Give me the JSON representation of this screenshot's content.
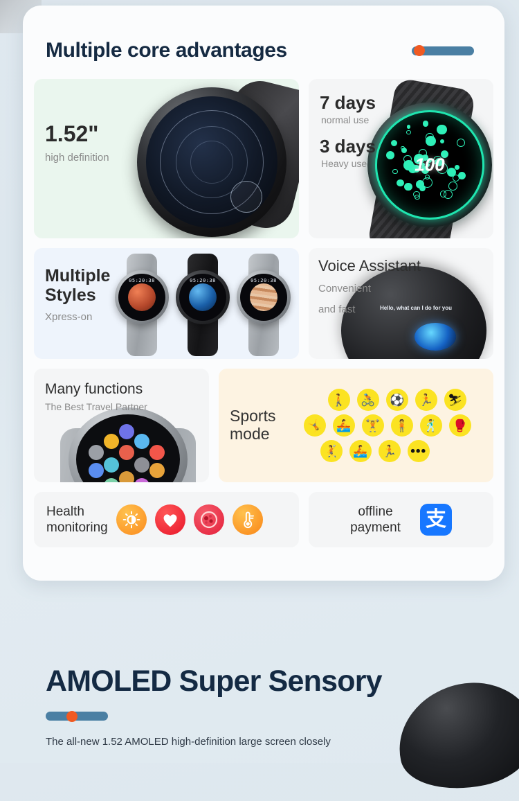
{
  "header": {
    "title": "Multiple core advantages",
    "accent_bar": {
      "track_color": "#4a7fa3",
      "dot_color": "#f05a22"
    }
  },
  "tiles": {
    "screen": {
      "name": "screen-size",
      "title": "1.52\"",
      "subtitle": "high definition",
      "bg_color": "#eaf6ee"
    },
    "battery": {
      "name": "battery-life",
      "normal_title": "7 days",
      "normal_sub": "normal use",
      "heavy_title": "3 days",
      "heavy_sub": "Heavy use",
      "watch_percent": "100",
      "bg_color": "#f4f5f6"
    },
    "styles": {
      "name": "multiple-styles",
      "title_line1": "Multiple",
      "title_line2": "Styles",
      "subtitle": "Xpress-on",
      "bg_color": "#eef4fc",
      "watch_faces": [
        {
          "label": "Mars",
          "time": "05:20:38"
        },
        {
          "label": "Earth",
          "time": "05:20:38"
        },
        {
          "label": "Jupiter",
          "time": "05:20:38"
        }
      ]
    },
    "voice": {
      "name": "voice-assistant",
      "title": "Voice Assistant",
      "subtitle_line1": "Convenient",
      "subtitle_line2": "and fast",
      "watch_text": "Hello, what can I do for you",
      "bg_color": "#f5f6f7"
    },
    "functions": {
      "name": "many-functions",
      "title": "Many functions",
      "subtitle": "The Best Travel Partner",
      "bg_color": "#f4f5f6"
    },
    "sports": {
      "name": "sports-mode",
      "title_line1": "Sports",
      "title_line2": "mode",
      "bg_color": "#fdf3e2",
      "icon_color": "#fbe322",
      "rows": [
        [
          {
            "name": "walking-icon",
            "glyph": "🚶"
          },
          {
            "name": "cycling-icon",
            "glyph": "🚴"
          },
          {
            "name": "football-icon",
            "glyph": "⚽"
          },
          {
            "name": "running-icon",
            "glyph": "🏃"
          },
          {
            "name": "skiing-icon",
            "glyph": "⛷"
          }
        ],
        [
          {
            "name": "stretching-icon",
            "glyph": "🤸"
          },
          {
            "name": "rowing-icon",
            "glyph": "🚣"
          },
          {
            "name": "weightlifting-icon",
            "glyph": "🏋"
          },
          {
            "name": "exercise-icon",
            "glyph": "🧍"
          },
          {
            "name": "dancing-icon",
            "glyph": "🕺"
          },
          {
            "name": "boxing-icon",
            "glyph": "🥊"
          }
        ],
        [
          {
            "name": "throwing-icon",
            "glyph": "🤾"
          },
          {
            "name": "rowing-machine-icon",
            "glyph": "🚣"
          },
          {
            "name": "treadmill-icon",
            "glyph": "🏃"
          },
          {
            "name": "more-sports-icon",
            "glyph": "•••"
          }
        ]
      ]
    },
    "health": {
      "name": "health-monitoring",
      "title_line1": "Health",
      "title_line2": "monitoring",
      "bg_color": "#f4f5f6",
      "icons": [
        {
          "name": "spo2-icon",
          "glyph": "☀"
        },
        {
          "name": "heart-rate-icon",
          "glyph": "♥"
        },
        {
          "name": "blood-cells-icon",
          "glyph": "●"
        },
        {
          "name": "thermometer-icon",
          "glyph": "🌡"
        }
      ]
    },
    "payment": {
      "name": "offline-payment",
      "title_line1": "offline",
      "title_line2": "payment",
      "bg_color": "#f4f5f6",
      "logo_name": "alipay-logo",
      "logo_glyph": "支",
      "logo_color": "#1777ff"
    }
  },
  "bottom": {
    "title": "AMOLED Super Sensory",
    "description": "The all-new 1.52 AMOLED high-definition large screen closely",
    "accent_bar": {
      "track_color": "#4a7fa3",
      "dot_color": "#f05a22"
    }
  }
}
